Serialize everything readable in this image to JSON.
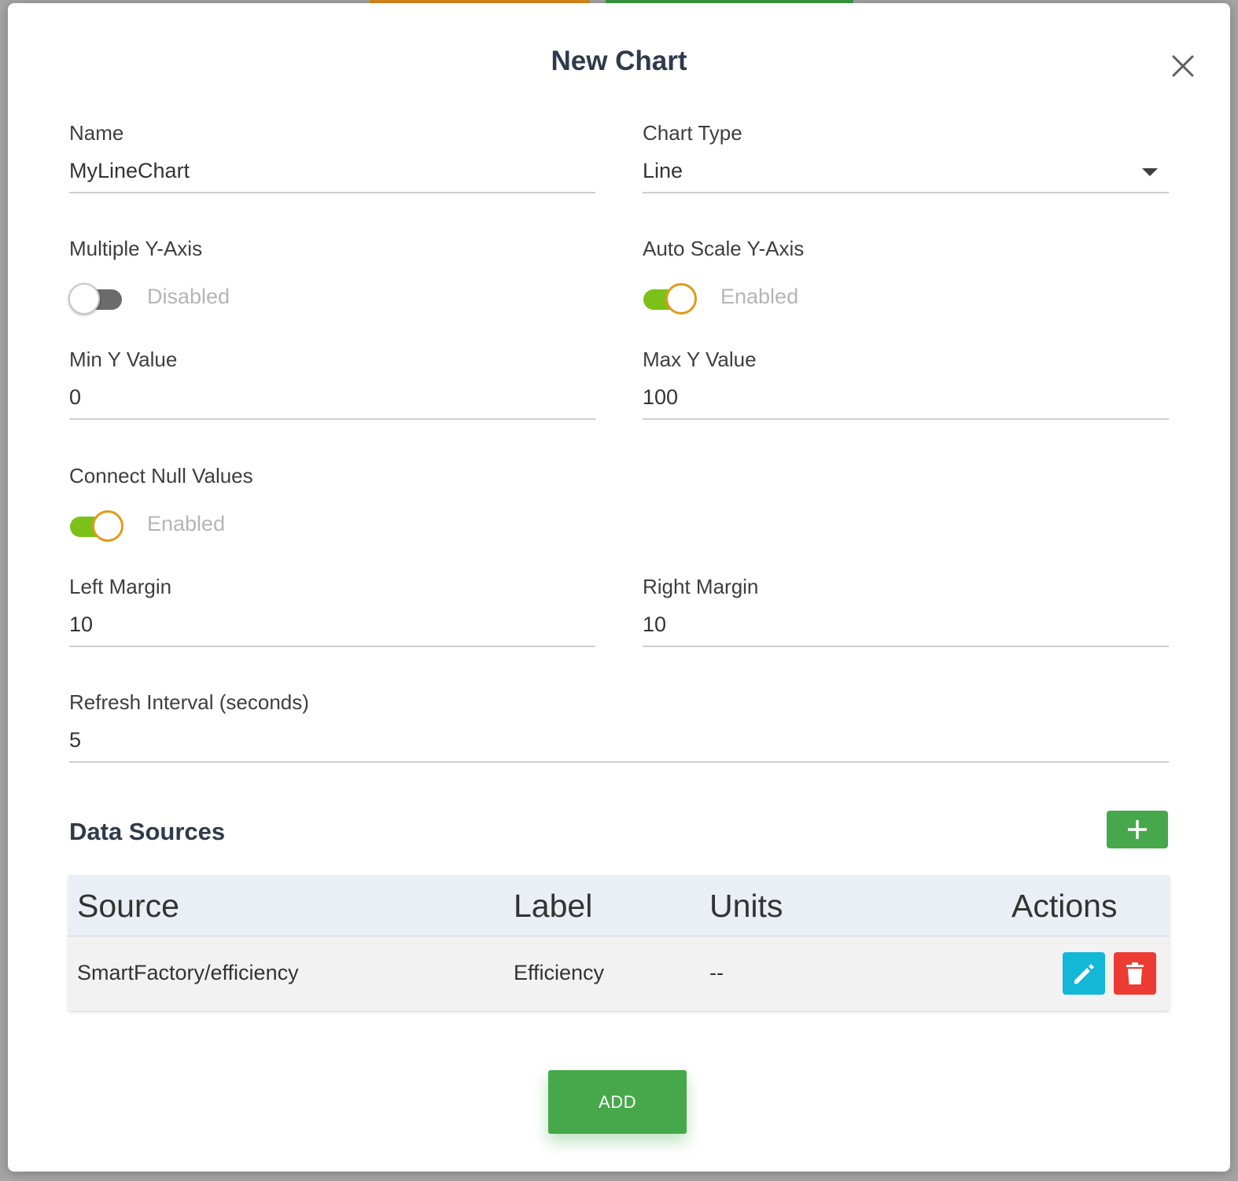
{
  "dialog": {
    "title": "New Chart",
    "close_icon": "close-icon"
  },
  "form": {
    "name": {
      "label": "Name",
      "value": "MyLineChart"
    },
    "chart_type": {
      "label": "Chart Type",
      "value": "Line"
    },
    "multiple_y_axis": {
      "label": "Multiple Y-Axis",
      "state": "Disabled",
      "on": false
    },
    "auto_scale_y_axis": {
      "label": "Auto Scale Y-Axis",
      "state": "Enabled",
      "on": true
    },
    "min_y": {
      "label": "Min Y Value",
      "value": "0"
    },
    "max_y": {
      "label": "Max Y Value",
      "value": "100"
    },
    "connect_null": {
      "label": "Connect Null Values",
      "state": "Enabled",
      "on": true
    },
    "left_margin": {
      "label": "Left Margin",
      "value": "10"
    },
    "right_margin": {
      "label": "Right Margin",
      "value": "10"
    },
    "refresh_interval": {
      "label": "Refresh Interval (seconds)",
      "value": "5"
    }
  },
  "data_sources": {
    "title": "Data Sources",
    "add_icon": "plus-icon",
    "columns": {
      "source": "Source",
      "label": "Label",
      "units": "Units",
      "actions": "Actions"
    },
    "rows": [
      {
        "source": "SmartFactory/efficiency",
        "label": "Efficiency",
        "units": "--"
      }
    ]
  },
  "footer": {
    "add_label": "ADD"
  },
  "colors": {
    "primary_green": "#46a84a",
    "toggle_on": "#7cc118",
    "toggle_knob_border": "#e29a1a",
    "edit_button": "#13b8d6",
    "delete_button": "#ec3b32"
  }
}
